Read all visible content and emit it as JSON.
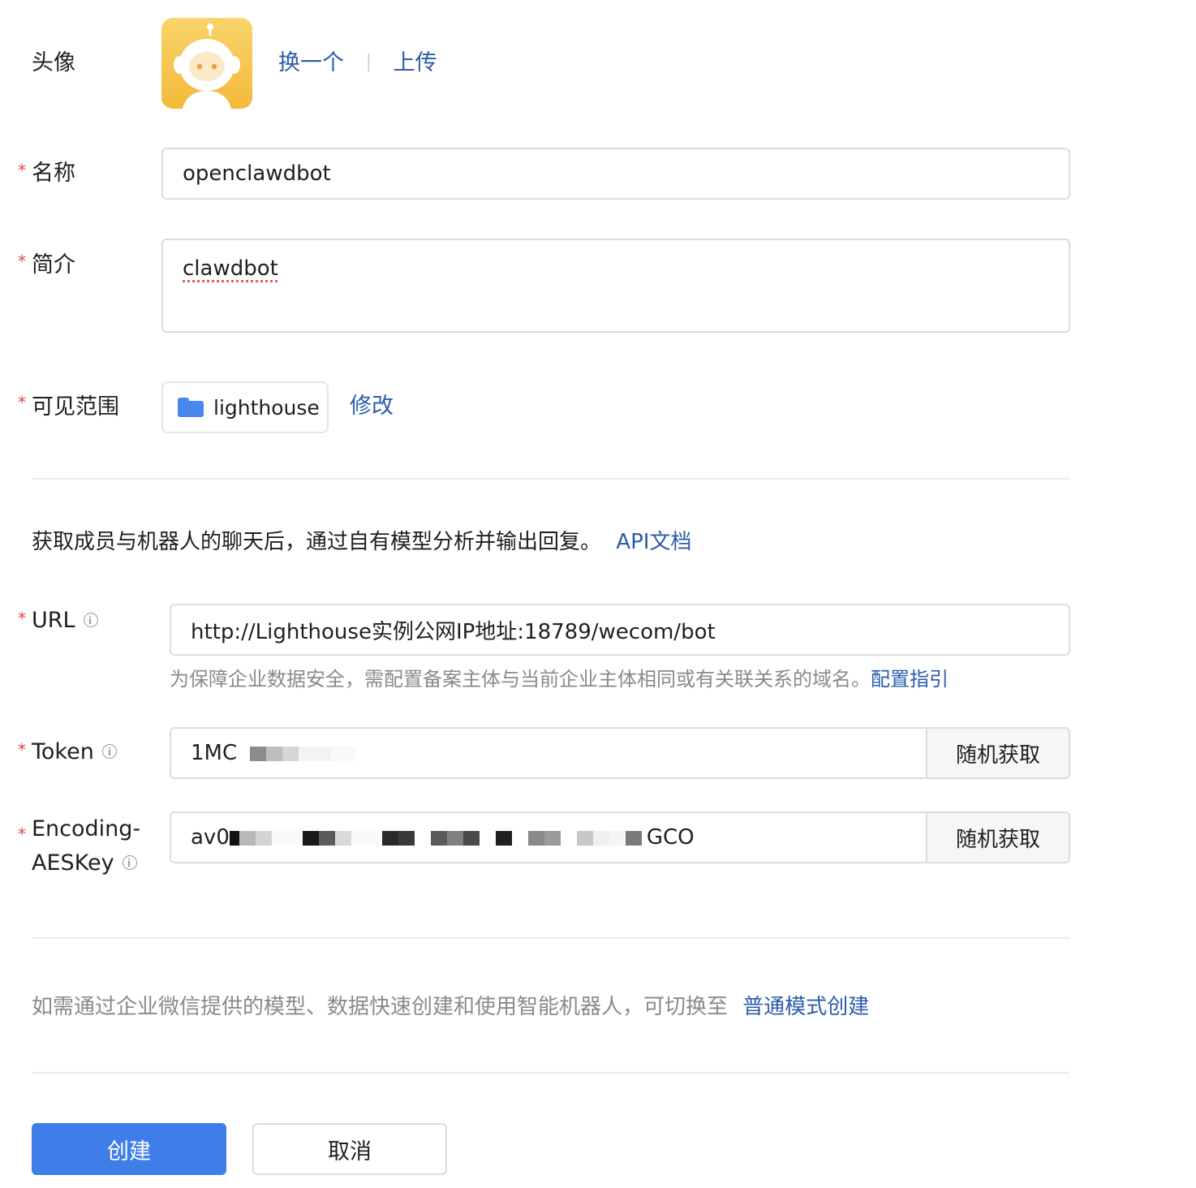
{
  "avatar": {
    "label": "头像",
    "change_link": "换一个",
    "separator": "|",
    "upload_link": "上传"
  },
  "name": {
    "label": "名称",
    "value": "openclawdbot"
  },
  "intro": {
    "label": "简介",
    "value": "clawdbot"
  },
  "scope": {
    "label": "可见范围",
    "chip": "lighthouse",
    "edit_link": "修改"
  },
  "api_section": {
    "description": "获取成员与机器人的聊天后，通过自有模型分析并输出回复。",
    "doc_link": "API文档"
  },
  "url": {
    "label": "URL",
    "value": "http://Lighthouse实例公网IP地址:18789/wecom/bot",
    "hint": "为保障企业数据安全，需配置备案主体与当前企业主体相同或有关联关系的域名。",
    "hint_link": "配置指引"
  },
  "token": {
    "label": "Token",
    "value_visible": "1MC",
    "random_button": "随机获取"
  },
  "aeskey": {
    "label_line1": "Encoding-",
    "label_line2": "AESKey",
    "value_prefix": "av0",
    "value_suffix": "GCO",
    "random_button": "随机获取"
  },
  "normal_mode": {
    "description": "如需通过企业微信提供的模型、数据快速创建和使用智能机器人，可切换至",
    "link": "普通模式创建"
  },
  "actions": {
    "create": "创建",
    "cancel": "取消"
  },
  "colors": {
    "link": "#2d5cab",
    "primary": "#3f7ee8",
    "required": "#e0483c",
    "folder": "#4a86f0"
  }
}
